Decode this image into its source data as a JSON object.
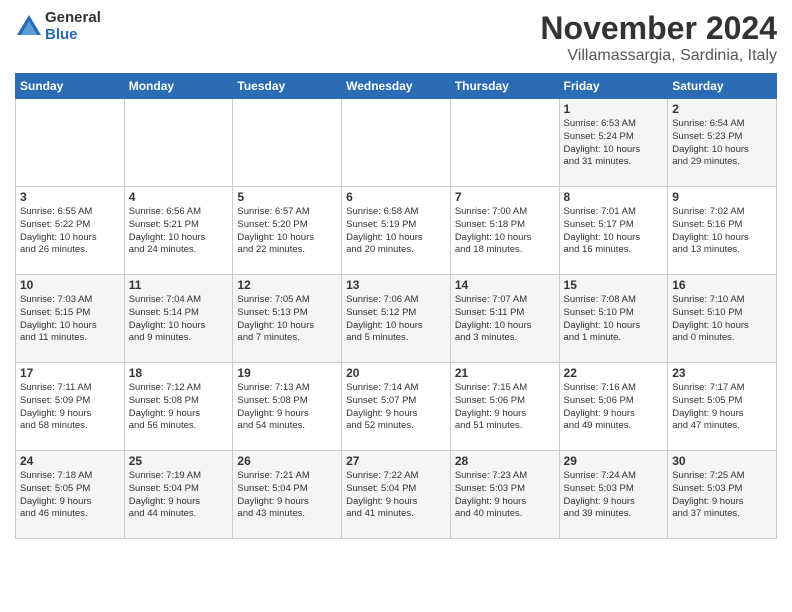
{
  "logo": {
    "general": "General",
    "blue": "Blue"
  },
  "title": "November 2024",
  "location": "Villamassargia, Sardinia, Italy",
  "days_of_week": [
    "Sunday",
    "Monday",
    "Tuesday",
    "Wednesday",
    "Thursday",
    "Friday",
    "Saturday"
  ],
  "weeks": [
    [
      {
        "day": "",
        "info": ""
      },
      {
        "day": "",
        "info": ""
      },
      {
        "day": "",
        "info": ""
      },
      {
        "day": "",
        "info": ""
      },
      {
        "day": "",
        "info": ""
      },
      {
        "day": "1",
        "info": "Sunrise: 6:53 AM\nSunset: 5:24 PM\nDaylight: 10 hours\nand 31 minutes."
      },
      {
        "day": "2",
        "info": "Sunrise: 6:54 AM\nSunset: 5:23 PM\nDaylight: 10 hours\nand 29 minutes."
      }
    ],
    [
      {
        "day": "3",
        "info": "Sunrise: 6:55 AM\nSunset: 5:22 PM\nDaylight: 10 hours\nand 26 minutes."
      },
      {
        "day": "4",
        "info": "Sunrise: 6:56 AM\nSunset: 5:21 PM\nDaylight: 10 hours\nand 24 minutes."
      },
      {
        "day": "5",
        "info": "Sunrise: 6:57 AM\nSunset: 5:20 PM\nDaylight: 10 hours\nand 22 minutes."
      },
      {
        "day": "6",
        "info": "Sunrise: 6:58 AM\nSunset: 5:19 PM\nDaylight: 10 hours\nand 20 minutes."
      },
      {
        "day": "7",
        "info": "Sunrise: 7:00 AM\nSunset: 5:18 PM\nDaylight: 10 hours\nand 18 minutes."
      },
      {
        "day": "8",
        "info": "Sunrise: 7:01 AM\nSunset: 5:17 PM\nDaylight: 10 hours\nand 16 minutes."
      },
      {
        "day": "9",
        "info": "Sunrise: 7:02 AM\nSunset: 5:16 PM\nDaylight: 10 hours\nand 13 minutes."
      }
    ],
    [
      {
        "day": "10",
        "info": "Sunrise: 7:03 AM\nSunset: 5:15 PM\nDaylight: 10 hours\nand 11 minutes."
      },
      {
        "day": "11",
        "info": "Sunrise: 7:04 AM\nSunset: 5:14 PM\nDaylight: 10 hours\nand 9 minutes."
      },
      {
        "day": "12",
        "info": "Sunrise: 7:05 AM\nSunset: 5:13 PM\nDaylight: 10 hours\nand 7 minutes."
      },
      {
        "day": "13",
        "info": "Sunrise: 7:06 AM\nSunset: 5:12 PM\nDaylight: 10 hours\nand 5 minutes."
      },
      {
        "day": "14",
        "info": "Sunrise: 7:07 AM\nSunset: 5:11 PM\nDaylight: 10 hours\nand 3 minutes."
      },
      {
        "day": "15",
        "info": "Sunrise: 7:08 AM\nSunset: 5:10 PM\nDaylight: 10 hours\nand 1 minute."
      },
      {
        "day": "16",
        "info": "Sunrise: 7:10 AM\nSunset: 5:10 PM\nDaylight: 10 hours\nand 0 minutes."
      }
    ],
    [
      {
        "day": "17",
        "info": "Sunrise: 7:11 AM\nSunset: 5:09 PM\nDaylight: 9 hours\nand 58 minutes."
      },
      {
        "day": "18",
        "info": "Sunrise: 7:12 AM\nSunset: 5:08 PM\nDaylight: 9 hours\nand 56 minutes."
      },
      {
        "day": "19",
        "info": "Sunrise: 7:13 AM\nSunset: 5:08 PM\nDaylight: 9 hours\nand 54 minutes."
      },
      {
        "day": "20",
        "info": "Sunrise: 7:14 AM\nSunset: 5:07 PM\nDaylight: 9 hours\nand 52 minutes."
      },
      {
        "day": "21",
        "info": "Sunrise: 7:15 AM\nSunset: 5:06 PM\nDaylight: 9 hours\nand 51 minutes."
      },
      {
        "day": "22",
        "info": "Sunrise: 7:16 AM\nSunset: 5:06 PM\nDaylight: 9 hours\nand 49 minutes."
      },
      {
        "day": "23",
        "info": "Sunrise: 7:17 AM\nSunset: 5:05 PM\nDaylight: 9 hours\nand 47 minutes."
      }
    ],
    [
      {
        "day": "24",
        "info": "Sunrise: 7:18 AM\nSunset: 5:05 PM\nDaylight: 9 hours\nand 46 minutes."
      },
      {
        "day": "25",
        "info": "Sunrise: 7:19 AM\nSunset: 5:04 PM\nDaylight: 9 hours\nand 44 minutes."
      },
      {
        "day": "26",
        "info": "Sunrise: 7:21 AM\nSunset: 5:04 PM\nDaylight: 9 hours\nand 43 minutes."
      },
      {
        "day": "27",
        "info": "Sunrise: 7:22 AM\nSunset: 5:04 PM\nDaylight: 9 hours\nand 41 minutes."
      },
      {
        "day": "28",
        "info": "Sunrise: 7:23 AM\nSunset: 5:03 PM\nDaylight: 9 hours\nand 40 minutes."
      },
      {
        "day": "29",
        "info": "Sunrise: 7:24 AM\nSunset: 5:03 PM\nDaylight: 9 hours\nand 39 minutes."
      },
      {
        "day": "30",
        "info": "Sunrise: 7:25 AM\nSunset: 5:03 PM\nDaylight: 9 hours\nand 37 minutes."
      }
    ]
  ]
}
